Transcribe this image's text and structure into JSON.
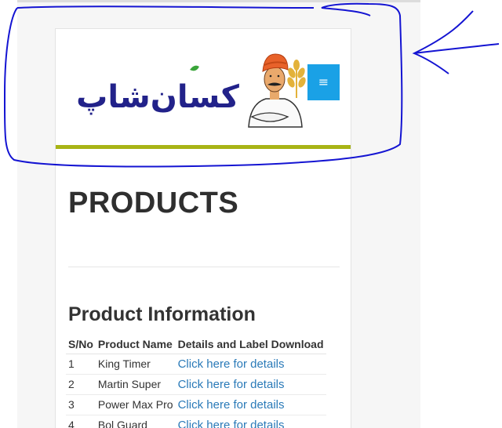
{
  "header": {
    "logo_text": "کسان‌شاپ",
    "menu_icon": "hamburger-icon",
    "menu_glyph": "≡"
  },
  "page": {
    "title": "PRODUCTS"
  },
  "section": {
    "title": "Product Information"
  },
  "table": {
    "columns": [
      "S/No",
      "Product Name",
      "Details and Label Download"
    ],
    "rows": [
      {
        "sno": "1",
        "name": "King Timer",
        "link": "Click here for details"
      },
      {
        "sno": "2",
        "name": "Martin Super",
        "link": "Click here for details"
      },
      {
        "sno": "3",
        "name": "Power Max Pro",
        "link": "Click here for details"
      },
      {
        "sno": "4",
        "name": "Bol Guard",
        "link": "Click here for details"
      }
    ]
  },
  "colors": {
    "logo_blue": "#22228a",
    "logo_green": "#3aa53a",
    "menu_button": "#1aa1e6",
    "accent_bar": "#a8b415",
    "link": "#2a7ab8",
    "annotation": "#1414d2"
  }
}
